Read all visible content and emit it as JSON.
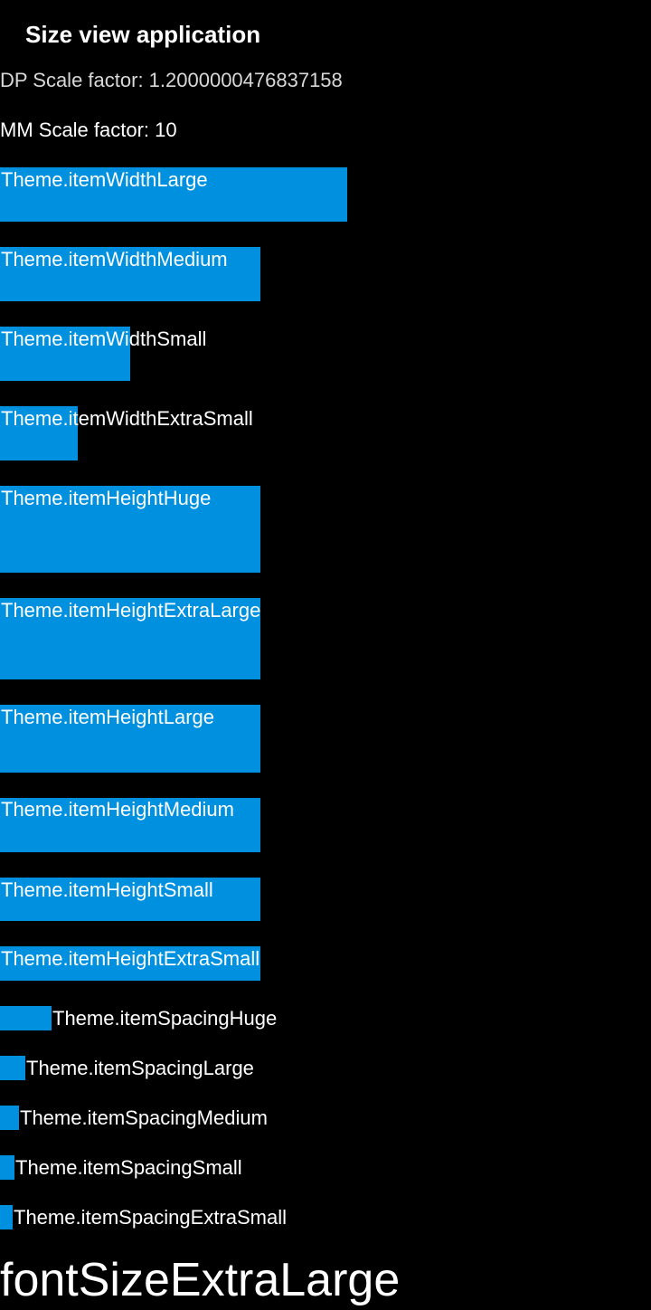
{
  "app": {
    "title": "Size view application",
    "dp_scale_text": "DP Scale factor: 1.2000000476837158",
    "mm_scale_text": "MM Scale factor: 10"
  },
  "colors": {
    "background": "#000000",
    "box": "#0090e0",
    "text": "#ffffff"
  },
  "width_items": [
    {
      "label": "Theme.itemWidthLarge"
    },
    {
      "label": "Theme.itemWidthMedium"
    },
    {
      "label": "Theme.itemWidthSmall"
    },
    {
      "label": "Theme.itemWidthExtraSmall"
    }
  ],
  "height_items": [
    {
      "label": "Theme.itemHeightHuge"
    },
    {
      "label": "Theme.itemHeightExtraLarge"
    },
    {
      "label": "Theme.itemHeightLarge"
    },
    {
      "label": "Theme.itemHeightMedium"
    },
    {
      "label": "Theme.itemHeightSmall"
    },
    {
      "label": "Theme.itemHeightExtraSmall"
    }
  ],
  "spacing_items": [
    {
      "label": "Theme.itemSpacingHuge"
    },
    {
      "label": "Theme.itemSpacingLarge"
    },
    {
      "label": "Theme.itemSpacingMedium"
    },
    {
      "label": "Theme.itemSpacingSmall"
    },
    {
      "label": "Theme.itemSpacingExtraSmall"
    }
  ],
  "font_sample": {
    "text": "fontSizeExtraLarge"
  }
}
